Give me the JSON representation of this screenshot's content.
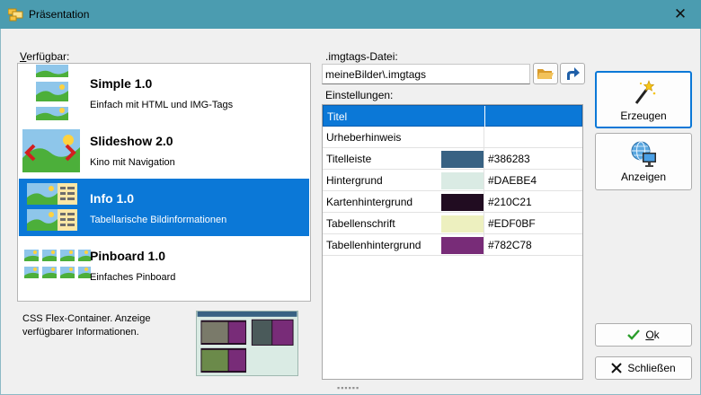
{
  "window": {
    "title": "Präsentation",
    "close_glyph": "✕"
  },
  "colors": {
    "titlebar": "#4b9cb0",
    "selection": "#0b78d7"
  },
  "available": {
    "label_mnemonic": "V",
    "label_rest": "erfügbar:",
    "items": [
      {
        "title": "Simple 1.0",
        "subtitle": "Einfach mit HTML und IMG-Tags",
        "icon": "simple-thumbnail-icon",
        "selected": false
      },
      {
        "title": "Slideshow 2.0",
        "subtitle": "Kino mit Navigation",
        "icon": "slideshow-thumbnail-icon",
        "selected": false
      },
      {
        "title": "Info 1.0",
        "subtitle": "Tabellarische Bildinformationen",
        "icon": "info-thumbnail-icon",
        "selected": true
      },
      {
        "title": "Pinboard 1.0",
        "subtitle": "Einfaches Pinboard",
        "icon": "pinboard-thumbnail-icon",
        "selected": false
      }
    ],
    "description": "CSS Flex-Container. Anzeige verfügbarer Informationen."
  },
  "file": {
    "label": ".imgtags-Datei:",
    "value": "meineBilder\\.imgtags"
  },
  "settings": {
    "label": "Einstellungen:",
    "rows": [
      {
        "name": "Titel",
        "swatch": null,
        "value": ""
      },
      {
        "name": "Urheberhinweis",
        "swatch": null,
        "value": ""
      },
      {
        "name": "Titelleiste",
        "swatch": "#386283",
        "value": "#386283"
      },
      {
        "name": "Hintergrund",
        "swatch": "#DAEBE4",
        "value": "#DAEBE4"
      },
      {
        "name": "Kartenhintergrund",
        "swatch": "#210C21",
        "value": "#210C21"
      },
      {
        "name": "Tabellenschrift",
        "swatch": "#EDF0BF",
        "value": "#EDF0BF"
      },
      {
        "name": "Tabellenhintergrund",
        "swatch": "#782C78",
        "value": "#782C78"
      }
    ]
  },
  "buttons": {
    "create": "Erzeugen",
    "show": "Anzeigen",
    "ok_mnemonic": "O",
    "ok_rest": "k",
    "close": "Schließen"
  }
}
